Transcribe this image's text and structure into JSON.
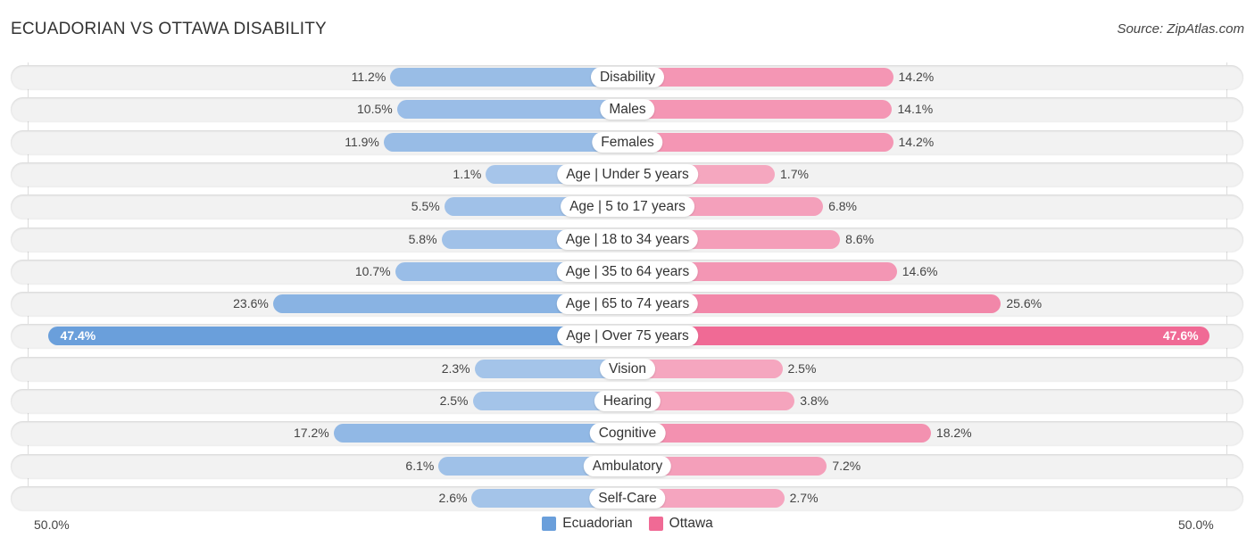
{
  "header": {
    "title": "ECUADORIAN VS OTTAWA DISABILITY",
    "source": "Source: ZipAtlas.com"
  },
  "colors": {
    "ecuadorian": "#6a9fdb",
    "ecuadorian_light": "#a7c6ea",
    "ottawa": "#f06a95",
    "ottawa_light": "#f5a9c1"
  },
  "chart_data": {
    "type": "bar",
    "orientation": "horizontal-diverging",
    "title": "ECUADORIAN VS OTTAWA DISABILITY",
    "categories": [
      "Disability",
      "Males",
      "Females",
      "Age | Under 5 years",
      "Age | 5 to 17 years",
      "Age | 18 to 34 years",
      "Age | 35 to 64 years",
      "Age | 65 to 74 years",
      "Age | Over 75 years",
      "Vision",
      "Hearing",
      "Cognitive",
      "Ambulatory",
      "Self-Care"
    ],
    "series": [
      {
        "name": "Ecuadorian",
        "values": [
          11.2,
          10.5,
          11.9,
          1.1,
          5.5,
          5.8,
          10.7,
          23.6,
          47.4,
          2.3,
          2.5,
          17.2,
          6.1,
          2.6
        ]
      },
      {
        "name": "Ottawa",
        "values": [
          14.2,
          14.1,
          14.2,
          1.7,
          6.8,
          8.6,
          14.6,
          25.6,
          47.6,
          2.5,
          3.8,
          18.2,
          7.2,
          2.7
        ]
      }
    ],
    "value_labels": {
      "Ecuadorian": [
        "11.2%",
        "10.5%",
        "11.9%",
        "1.1%",
        "5.5%",
        "5.8%",
        "10.7%",
        "23.6%",
        "47.4%",
        "2.3%",
        "2.5%",
        "17.2%",
        "6.1%",
        "2.6%"
      ],
      "Ottawa": [
        "14.2%",
        "14.1%",
        "14.2%",
        "1.7%",
        "6.8%",
        "8.6%",
        "14.6%",
        "25.6%",
        "47.6%",
        "2.5%",
        "3.8%",
        "18.2%",
        "7.2%",
        "2.7%"
      ]
    },
    "axis": {
      "left_label": "50.0%",
      "right_label": "50.0%",
      "range": [
        0,
        50
      ]
    },
    "legend": {
      "position": "bottom-center",
      "entries": [
        "Ecuadorian",
        "Ottawa"
      ]
    },
    "grid": false
  }
}
